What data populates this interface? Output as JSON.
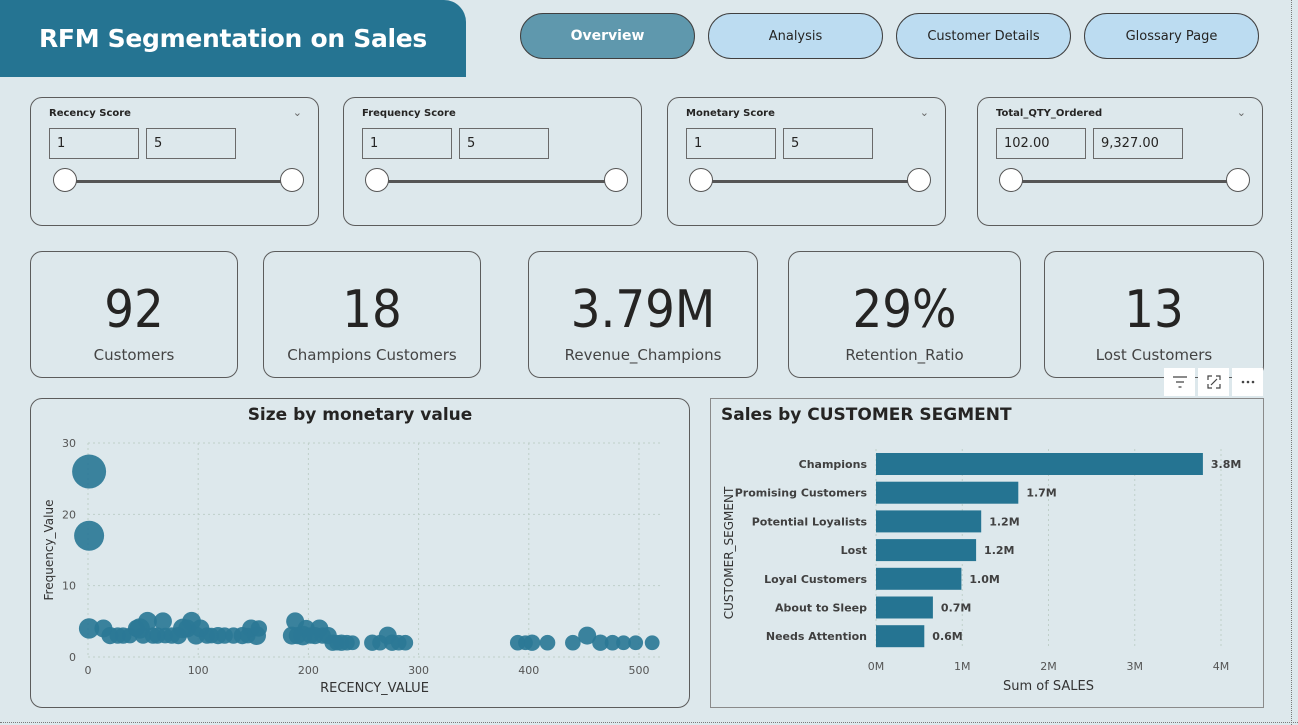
{
  "header": {
    "title": "RFM Segmentation on Sales"
  },
  "nav": [
    {
      "label": "Overview",
      "active": true
    },
    {
      "label": "Analysis",
      "active": false
    },
    {
      "label": "Customer Details",
      "active": false
    },
    {
      "label": "Glossary Page",
      "active": false
    }
  ],
  "slicers": [
    {
      "title": "Recency Score",
      "min": "1",
      "max": "5"
    },
    {
      "title": "Frequency Score",
      "min": "1",
      "max": "5"
    },
    {
      "title": "Monetary Score",
      "min": "1",
      "max": "5"
    },
    {
      "title": "Total_QTY_Ordered",
      "min": "102.00",
      "max": "9,327.00"
    }
  ],
  "kpis": [
    {
      "value": "92",
      "label": "Customers"
    },
    {
      "value": "18",
      "label": "Champions Customers"
    },
    {
      "value": "3.79M",
      "label": "Revenue_Champions"
    },
    {
      "value": "29%",
      "label": "Retention_Ratio"
    },
    {
      "value": "13",
      "label": "Lost Customers"
    }
  ],
  "visual_toolbar": {
    "icons": [
      "filter-icon",
      "focus-mode-icon",
      "more-options-icon"
    ]
  },
  "colors": {
    "accent": "#257492",
    "bubble": "#2b7896",
    "background": "#dde8ec",
    "nav_inactive": "#bcdcf1",
    "nav_active": "#5f98ad"
  },
  "chart_data": [
    {
      "type": "scatter",
      "title": "Size by monetary value",
      "xlabel": "RECENCY_VALUE",
      "ylabel": "Frequency_Value",
      "xlim": [
        0,
        520
      ],
      "ylim": [
        0,
        30
      ],
      "xticks": [
        0,
        100,
        200,
        300,
        400,
        500
      ],
      "yticks": [
        0,
        10,
        20,
        30
      ],
      "grid": true,
      "points": [
        {
          "x": 1,
          "y": 26,
          "size": 3.0
        },
        {
          "x": 1,
          "y": 17,
          "size": 2.5
        },
        {
          "x": 1,
          "y": 4,
          "size": 1.3
        },
        {
          "x": 14,
          "y": 4,
          "size": 1.0
        },
        {
          "x": 20,
          "y": 3,
          "size": 0.9
        },
        {
          "x": 27,
          "y": 3,
          "size": 0.8
        },
        {
          "x": 32,
          "y": 3,
          "size": 0.8
        },
        {
          "x": 38,
          "y": 3,
          "size": 0.7
        },
        {
          "x": 44,
          "y": 4,
          "size": 0.9
        },
        {
          "x": 47,
          "y": 4,
          "size": 1.3
        },
        {
          "x": 50,
          "y": 3,
          "size": 0.8
        },
        {
          "x": 54,
          "y": 5,
          "size": 1.1
        },
        {
          "x": 59,
          "y": 3,
          "size": 0.8
        },
        {
          "x": 63,
          "y": 3,
          "size": 0.8
        },
        {
          "x": 68,
          "y": 5,
          "size": 1.0
        },
        {
          "x": 70,
          "y": 3,
          "size": 0.7
        },
        {
          "x": 76,
          "y": 3,
          "size": 0.8
        },
        {
          "x": 82,
          "y": 3,
          "size": 0.9
        },
        {
          "x": 86,
          "y": 4,
          "size": 1.2
        },
        {
          "x": 90,
          "y": 4,
          "size": 1.0
        },
        {
          "x": 94,
          "y": 5,
          "size": 1.1
        },
        {
          "x": 98,
          "y": 3,
          "size": 1.0
        },
        {
          "x": 102,
          "y": 4,
          "size": 1.0
        },
        {
          "x": 108,
          "y": 3,
          "size": 0.8
        },
        {
          "x": 112,
          "y": 3,
          "size": 0.7
        },
        {
          "x": 118,
          "y": 3,
          "size": 0.9
        },
        {
          "x": 124,
          "y": 3,
          "size": 0.8
        },
        {
          "x": 132,
          "y": 3,
          "size": 0.8
        },
        {
          "x": 140,
          "y": 3,
          "size": 0.9
        },
        {
          "x": 145,
          "y": 3,
          "size": 0.7
        },
        {
          "x": 148,
          "y": 4,
          "size": 1.0
        },
        {
          "x": 153,
          "y": 3,
          "size": 1.1
        },
        {
          "x": 155,
          "y": 4,
          "size": 0.8
        },
        {
          "x": 185,
          "y": 3,
          "size": 1.0
        },
        {
          "x": 188,
          "y": 5,
          "size": 1.0
        },
        {
          "x": 190,
          "y": 3,
          "size": 0.9
        },
        {
          "x": 195,
          "y": 3,
          "size": 1.2
        },
        {
          "x": 198,
          "y": 4,
          "size": 0.9
        },
        {
          "x": 202,
          "y": 3,
          "size": 0.8
        },
        {
          "x": 206,
          "y": 3,
          "size": 0.9
        },
        {
          "x": 210,
          "y": 4,
          "size": 1.0
        },
        {
          "x": 213,
          "y": 3,
          "size": 0.8
        },
        {
          "x": 218,
          "y": 3,
          "size": 0.9
        },
        {
          "x": 222,
          "y": 2,
          "size": 0.8
        },
        {
          "x": 226,
          "y": 2,
          "size": 0.7
        },
        {
          "x": 230,
          "y": 2,
          "size": 0.8
        },
        {
          "x": 235,
          "y": 2,
          "size": 0.7
        },
        {
          "x": 240,
          "y": 2,
          "size": 0.6
        },
        {
          "x": 258,
          "y": 2,
          "size": 0.8
        },
        {
          "x": 265,
          "y": 2,
          "size": 0.7
        },
        {
          "x": 272,
          "y": 3,
          "size": 1.0
        },
        {
          "x": 276,
          "y": 2,
          "size": 0.8
        },
        {
          "x": 282,
          "y": 2,
          "size": 0.7
        },
        {
          "x": 288,
          "y": 2,
          "size": 0.7
        },
        {
          "x": 390,
          "y": 2,
          "size": 0.7
        },
        {
          "x": 397,
          "y": 2,
          "size": 0.6
        },
        {
          "x": 403,
          "y": 2,
          "size": 0.8
        },
        {
          "x": 417,
          "y": 2,
          "size": 0.7
        },
        {
          "x": 440,
          "y": 2,
          "size": 0.7
        },
        {
          "x": 453,
          "y": 3,
          "size": 1.0
        },
        {
          "x": 465,
          "y": 2,
          "size": 0.8
        },
        {
          "x": 476,
          "y": 2,
          "size": 0.7
        },
        {
          "x": 486,
          "y": 2,
          "size": 0.6
        },
        {
          "x": 497,
          "y": 2,
          "size": 0.6
        },
        {
          "x": 512,
          "y": 2,
          "size": 0.6
        }
      ]
    },
    {
      "type": "bar",
      "orientation": "horizontal",
      "title": "Sales by CUSTOMER SEGMENT",
      "xlabel": "Sum of SALES",
      "ylabel": "CUSTOMER_SEGMENT",
      "xlim": [
        0,
        4000000
      ],
      "xticks": [
        {
          "value": 0,
          "label": "0M"
        },
        {
          "value": 1000000,
          "label": "1M"
        },
        {
          "value": 2000000,
          "label": "2M"
        },
        {
          "value": 3000000,
          "label": "3M"
        },
        {
          "value": 4000000,
          "label": "4M"
        }
      ],
      "categories": [
        "Champions",
        "Promising Customers",
        "Potential Loyalists",
        "Lost",
        "Loyal Customers",
        "About to Sleep",
        "Needs Attention"
      ],
      "values": [
        3790000,
        1650000,
        1220000,
        1160000,
        990000,
        660000,
        560000
      ],
      "data_labels": [
        "3.8M",
        "1.7M",
        "1.2M",
        "1.2M",
        "1.0M",
        "0.7M",
        "0.6M"
      ],
      "grid": true
    }
  ]
}
